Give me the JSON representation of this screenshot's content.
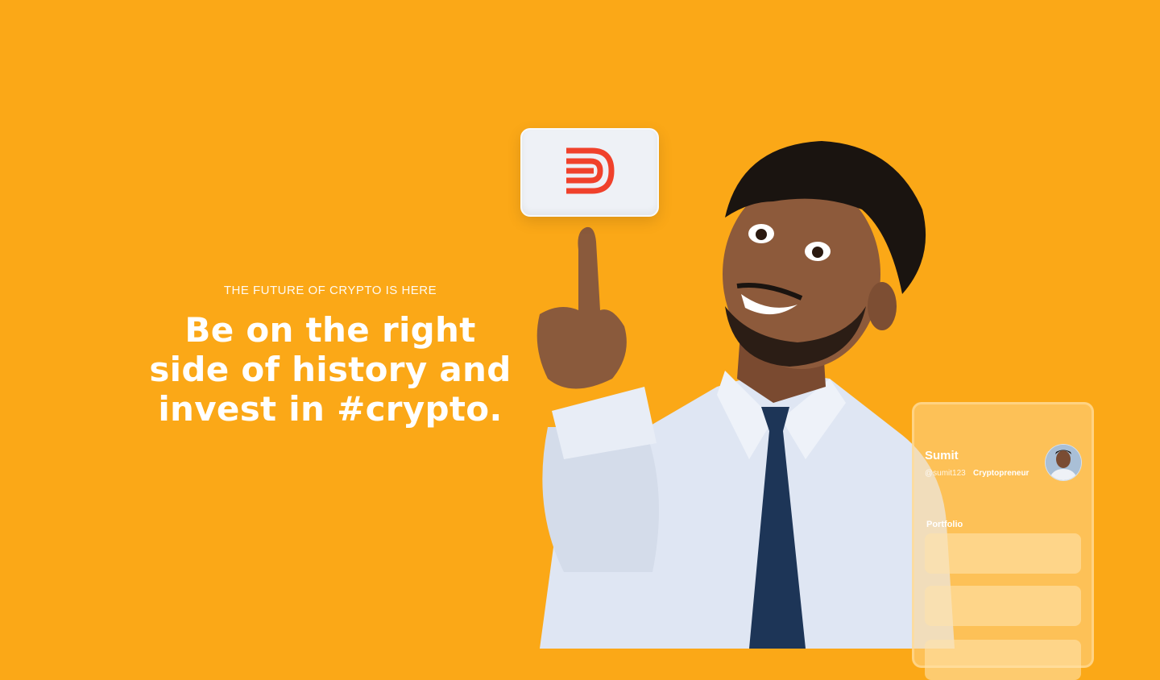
{
  "hero": {
    "eyebrow": "THE FUTURE OF CRYPTO IS HERE",
    "headline_line1": "Be on the right",
    "headline_line2": "side of history and",
    "headline_line3": "invest in #crypto."
  },
  "logo": {
    "icon": "brand-b-logo-icon",
    "color": "#F0412B"
  },
  "profile": {
    "name": "Sumit",
    "handle": "@sumit123",
    "role": "Cryptopreneur",
    "portfolio_label": "Portfolio"
  },
  "colors": {
    "background": "#FBA817",
    "text": "#FFFFFF"
  }
}
